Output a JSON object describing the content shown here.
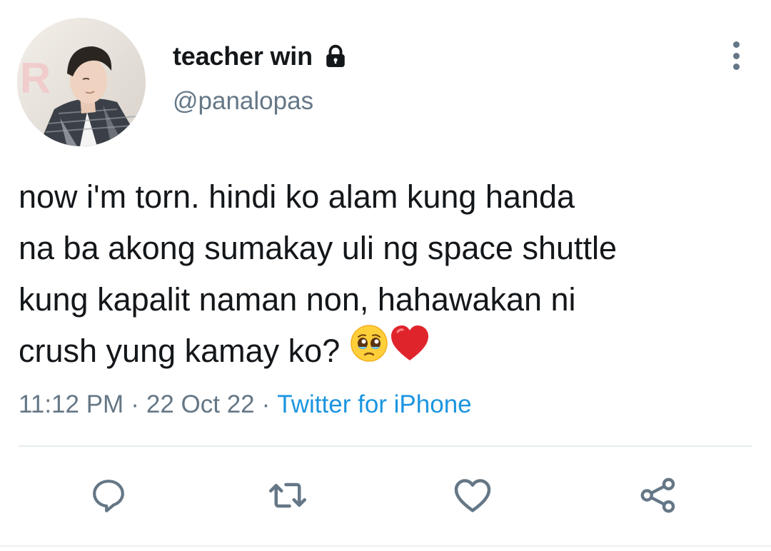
{
  "user": {
    "display_name": "teacher win",
    "handle": "@panalopas",
    "protected_icon": "lock-icon",
    "avatar": "profile-photo"
  },
  "tweet": {
    "lines": [
      "now i'm torn. hindi ko alam kung handa",
      "na ba akong sumakay uli ng space shuttle",
      "kung kapalit naman non, hahawakan ni",
      "crush yung kamay ko?"
    ],
    "emojis": [
      "pleading-face-emoji",
      "red-heart-emoji"
    ]
  },
  "meta": {
    "time": "11:12 PM",
    "separator": "·",
    "date": "22 Oct 22",
    "source": "Twitter for iPhone"
  },
  "actions": {
    "reply_icon": "reply-icon",
    "retweet_icon": "retweet-icon",
    "like_icon": "heart-icon",
    "share_icon": "share-icon",
    "more_icon": "more-vertical-icon"
  },
  "colors": {
    "primary_text": "#14171a",
    "secondary_text": "#657786",
    "link": "#1b95e0",
    "divider": "#e6ecf0"
  }
}
